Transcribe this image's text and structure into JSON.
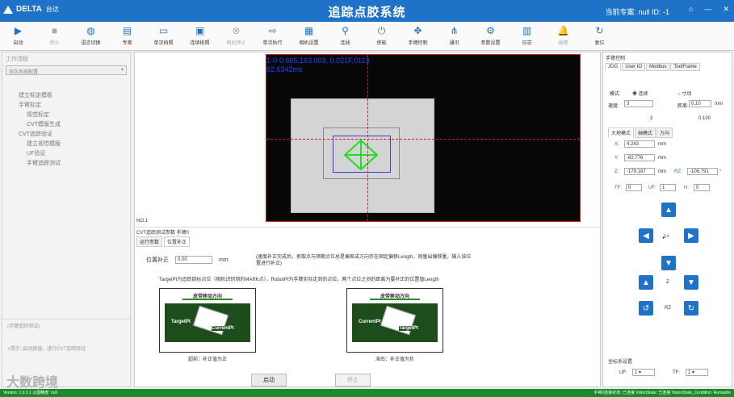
{
  "title_bar": {
    "logo": "DELTA",
    "logo_cn": "台达",
    "app_title": "追踪点胶系统",
    "project_label": "当前专案: null  ID: -1",
    "controls": [
      "⌂",
      "—",
      "✕"
    ]
  },
  "toolbar": [
    {
      "label": "启动",
      "icon": "play-icon",
      "glyph": "▶",
      "enabled": true
    },
    {
      "label": "停止",
      "icon": "stop-icon",
      "glyph": "■",
      "enabled": false
    },
    {
      "label": "语言切换",
      "icon": "globe-icon",
      "glyph": "◍",
      "enabled": true
    },
    {
      "label": "专案",
      "icon": "project-icon",
      "glyph": "▤",
      "enabled": true
    },
    {
      "label": "单次拍照",
      "icon": "single-shot-icon",
      "glyph": "▭",
      "enabled": true
    },
    {
      "label": "连续拍照",
      "icon": "continuous-shot-icon",
      "glyph": "▣",
      "enabled": true
    },
    {
      "label": "相机停止",
      "icon": "camera-stop-icon",
      "glyph": "⊗",
      "enabled": false
    },
    {
      "label": "单次执行",
      "icon": "single-run-icon",
      "glyph": "⇨",
      "enabled": true
    },
    {
      "label": "相机设置",
      "icon": "camera-settings-icon",
      "glyph": "▦",
      "enabled": true
    },
    {
      "label": "连线",
      "icon": "connect-icon",
      "glyph": "⚲",
      "enabled": true
    },
    {
      "label": "使能",
      "icon": "enable-icon",
      "glyph": "⏻",
      "enabled": true
    },
    {
      "label": "手臂控制",
      "icon": "arm-control-icon",
      "glyph": "✥",
      "enabled": true
    },
    {
      "label": "通讯",
      "icon": "communication-icon",
      "glyph": "⋔",
      "enabled": true
    },
    {
      "label": "参数设置",
      "icon": "settings-icon",
      "glyph": "⚙",
      "enabled": true
    },
    {
      "label": "日志",
      "icon": "log-icon",
      "glyph": "▥",
      "enabled": true
    },
    {
      "label": "报警",
      "icon": "alarm-icon",
      "glyph": "🔔",
      "enabled": false
    },
    {
      "label": "复位",
      "icon": "reset-icon",
      "glyph": "↻",
      "enabled": true
    }
  ],
  "left": {
    "title": "工作流程",
    "select": "测次系统配置",
    "tree": [
      "建立标定模板",
      "手臂标定",
      "视觉标定",
      "CVT模版生成",
      "CVT追踪验证",
      "建立视觉模版",
      "UF验证",
      "手臂追踪测试"
    ],
    "hint1": "(手臂追踪测试)",
    "hint2": "+提示:-启动按钮，进行CVT追踪验证"
  },
  "camera": {
    "overlay1": "1-0-0.665,163.003, 0.021F,0113",
    "overlay2": "62.6342ms"
  },
  "center": {
    "no_label": "NO.1",
    "section_title": "CVT追踪测试参数  手臂0",
    "subtabs": [
      "运行参数",
      "位置补正"
    ],
    "comp_label": "位置补正",
    "comp_value": "0.00",
    "comp_unit": "mm",
    "note": "(速度补正完成后，抓取点与预期点位总是偏差成方向存在固定偏移Length，则量出偏移量，输入该位置进行补正)",
    "note2": "TargetPt为追踪目标点位（相机识别到的MARK点），RobotPt为手臂实际走到的点位。两个点位之间的距离为要补正的位置值Length",
    "illus_head": "皮带移动方向",
    "illus_left_labels": [
      "TargetPt",
      "CurrentPt"
    ],
    "illus_right_labels": [
      "CurrentPt",
      "TargetPt"
    ],
    "cap_left": "超前：补正值为正",
    "cap_right": "滞后：补正值为负",
    "start": "启动",
    "stop": "停止"
  },
  "right": {
    "title": "手臂控制",
    "tabs": [
      "JOG",
      "User IO",
      "Modbus",
      "ToolFrame"
    ],
    "mode_label": "模式:",
    "mode_cont": "连续",
    "mode_step": "寸动",
    "speed_label": "速度:",
    "speed": "3",
    "dist_label": "距离:",
    "dist": "0.10",
    "dist_unit": "mm",
    "speed_val": "3",
    "dist_val": "0.100",
    "coord_tabs": [
      "大地模式",
      "轴模式",
      "方向"
    ],
    "x_label": "X:",
    "x": "4.243",
    "x_unit": "mm",
    "y_label": "Y:",
    "y": "-82.776",
    "y_unit": "mm",
    "z_label": "Z:",
    "z": "-179.187",
    "z_unit": "mm",
    "rz_label": "RZ:",
    "rz": "-106.791",
    "rz_unit": "°",
    "tf_label": "TF:",
    "tf": "0",
    "uf_label": "UF:",
    "uf": "1",
    "h_label": "H:",
    "h": "0",
    "z_axis": "Z",
    "rz_axis": "RZ",
    "coord_sys": "坐标系设置",
    "uf_sel": "1",
    "tf_sel": "1"
  },
  "statusbar": {
    "left": "Version: 1.0.0.1  以图精度: null",
    "right": "手臂0连接状态: 已连接   VisionState: 已连接  VisionState_Condition: Runnable"
  },
  "watermark": "大数跨境"
}
